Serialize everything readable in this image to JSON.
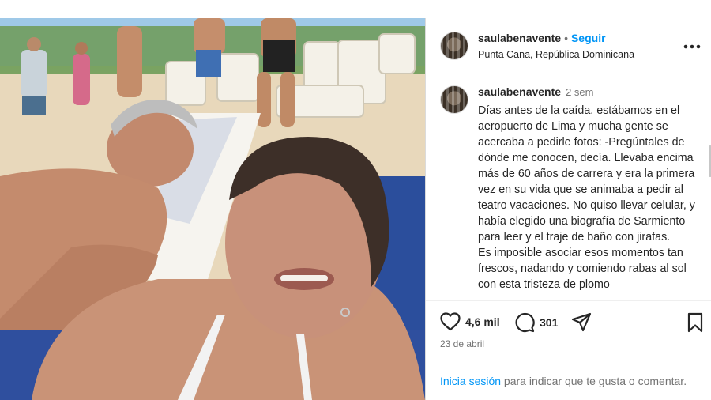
{
  "post": {
    "username": "saulabenavente",
    "dot": "•",
    "follow_label": "Seguir",
    "location": "Punta Cana, República Dominicana",
    "more_icon": "more-horizontal-icon",
    "caption_username": "saulabenavente",
    "caption_age": "2 sem",
    "caption_text": "Días antes de la caída, estábamos en el aeropuerto de Lima y mucha gente se acercaba a pedirle fotos: -Pregúntales de dónde me conocen, decía. Llevaba encima más de 60 años de carrera y era la primera vez en su vida que se animaba a pedir al teatro vacaciones. No quiso llevar celular, y había elegido una biografía de Sarmiento para leer y el traje de baño con jirafas.\nEs imposible asociar esos momentos tan frescos, nadando y comiendo rabas al sol con esta tristeza de plomo",
    "likes": "4,6 mil",
    "comments": "301",
    "date": "23 de abril",
    "login_link": "Inicia sesión",
    "login_rest": " para indicar que te gusta o comentar."
  },
  "colors": {
    "accent": "#0095f6",
    "muted": "#737373",
    "text": "#262626"
  }
}
